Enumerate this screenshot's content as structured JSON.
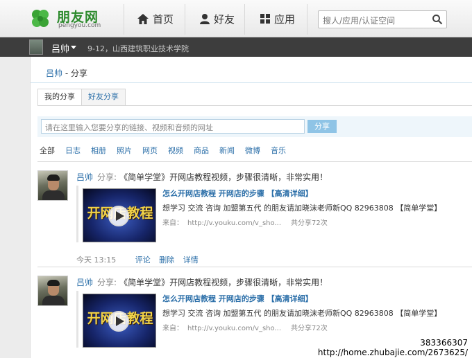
{
  "header": {
    "brand": "朋友网",
    "domain": "pengyou.com",
    "nav": [
      {
        "label": "首页",
        "icon": "home-icon"
      },
      {
        "label": "好友",
        "icon": "friends-icon"
      },
      {
        "label": "应用",
        "icon": "apps-grid-icon"
      }
    ],
    "search_placeholder": "搜人/应用/认证空间"
  },
  "userbar": {
    "name": "吕帅",
    "info": "9-12，山西建筑职业技术学院"
  },
  "breadcrumb": {
    "user": "吕帅",
    "separator": " - ",
    "page": "分享"
  },
  "tabs": [
    {
      "label": "我的分享",
      "active": true
    },
    {
      "label": "好友分享",
      "active": false
    }
  ],
  "share": {
    "placeholder": "请在这里输入您要分享的链接、视频和音频的网址",
    "button": "分享"
  },
  "filters": [
    "全部",
    "日志",
    "相册",
    "照片",
    "网页",
    "视频",
    "商品",
    "新闻",
    "微博",
    "音乐"
  ],
  "feed": [
    {
      "user": "吕帅",
      "verb": "分享:",
      "message": "《简单学堂》开网店教程视频，步骤很清晰，非常实用！",
      "thumb_text": "开网店教程",
      "title": "怎么开网店教程  开网店的步骤 【高清详细】",
      "desc": "想学习 交流 咨询 加盟第五代 的朋友请加晓沫老师新QQ 82963808 【简单学堂】",
      "source_label": "来自：",
      "source_url": "http://v.youku.com/v_sho...",
      "share_count": "共分享72次",
      "time": "今天 13:15",
      "actions": [
        "评论",
        "删除",
        "详情"
      ]
    },
    {
      "user": "吕帅",
      "verb": "分享:",
      "message": "《简单学堂》开网店教程视频，步骤很清晰，非常实用！",
      "thumb_text": "开网店教程",
      "title": "怎么开网店教程  开网店的步骤 【高清详细】",
      "desc": "想学习 交流 咨询 加盟第五代 的朋友请加晓沫老师新QQ 82963808 【简单学堂】",
      "source_label": "来自：",
      "source_url": "http://v.youku.com/v_sho...",
      "share_count": "共分享72次"
    }
  ],
  "watermark": {
    "line1": "383366307",
    "line2": "http://home.zhubajie.com/2673625/"
  },
  "colors": {
    "link": "#2a6ea8",
    "brand_green": "#2c8a2c",
    "userbar_bg": "#3d3d3d",
    "share_button": "#8fc4e6"
  }
}
